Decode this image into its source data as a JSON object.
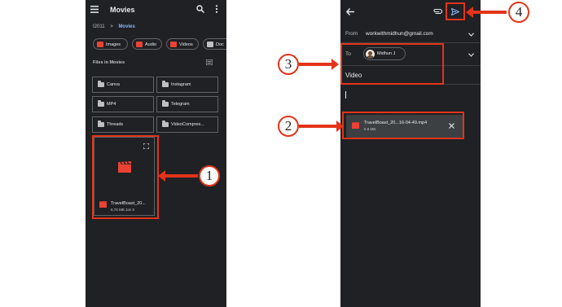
{
  "files_app": {
    "title": "Movies",
    "breadcrumb": {
      "root": "I2011",
      "separator": ">",
      "current": "Movies"
    },
    "chips": [
      {
        "label": "Images"
      },
      {
        "label": "Audio"
      },
      {
        "label": "Videos"
      },
      {
        "label": "Doc"
      }
    ],
    "section_label": "Files in Movies",
    "folders": [
      {
        "name": "Canva"
      },
      {
        "name": "Instagram"
      },
      {
        "name": "MP4"
      },
      {
        "name": "Telegram"
      },
      {
        "name": "Threads"
      },
      {
        "name": "VideoCompres..."
      }
    ],
    "video_file": {
      "name": "TravelBoast_20...",
      "meta": "6.78 MB Jan 8"
    }
  },
  "gmail_compose": {
    "from_label": "From",
    "from_value": "workwithmidhun@gmail.com",
    "to_label": "To",
    "recipient": "Midhun J",
    "subject": "Video",
    "attachment": {
      "name": "TravelBoast_20...16-04-49.mp4",
      "size": "6.8 MB"
    }
  },
  "callouts": [
    "1",
    "2",
    "3",
    "4"
  ],
  "colors": {
    "annotation_red": "#e3341a",
    "dark_bg": "#202124",
    "accent_blue": "#8ab4f8",
    "file_red": "#ea4335"
  },
  "icons": [
    "menu-icon",
    "search-icon",
    "more-vert-icon",
    "list-view-icon",
    "folder-icon",
    "video-file-icon",
    "fullscreen-icon",
    "back-arrow-icon",
    "attach-icon",
    "send-icon",
    "chevron-down-icon",
    "close-icon"
  ]
}
